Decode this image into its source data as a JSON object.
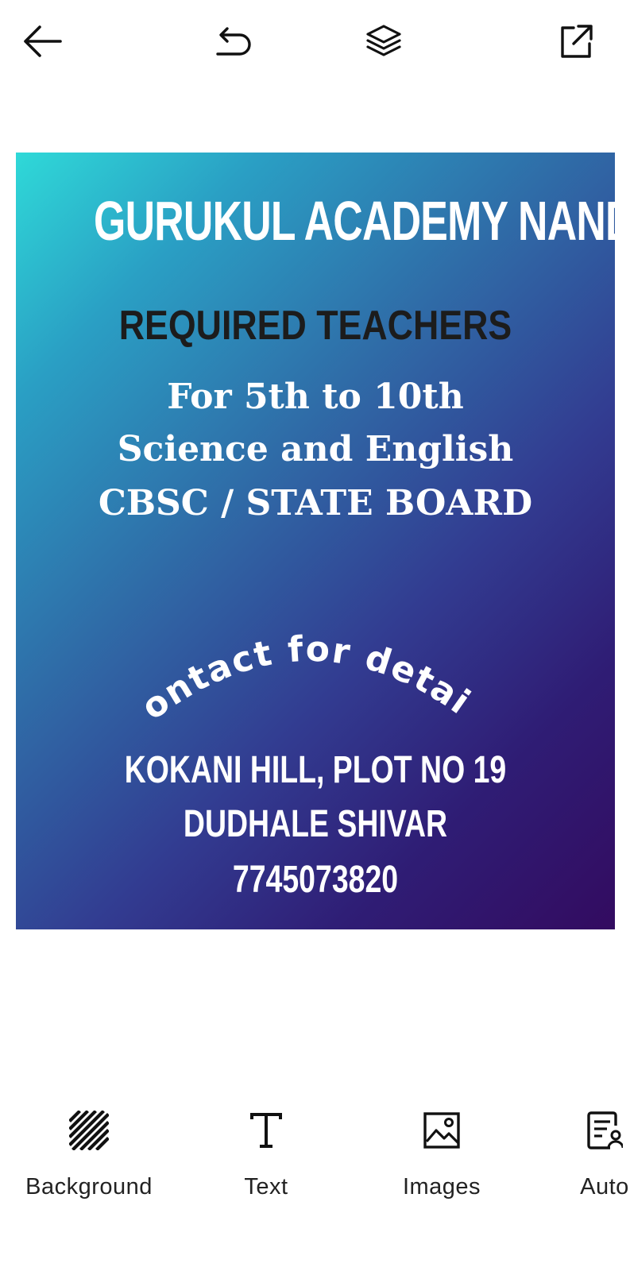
{
  "toolbar": {
    "back_icon": "arrow-left-icon",
    "undo_icon": "undo-icon",
    "layers_icon": "layers-icon",
    "share_icon": "external-share-icon"
  },
  "poster": {
    "title": "GURUKUL ACADEMY NANDURBAR",
    "subtitle": "REQUIRED TEACHERS",
    "line1": "For 5th to 10th",
    "line2": "Science and English",
    "line3": "CBSC / STATE BOARD",
    "contact": "Contact for details",
    "address1": "KOKANI HILL, PLOT NO 19",
    "address2": "DUDHALE SHIVAR",
    "phone": "7745073820",
    "gradient_start": "#2fd9d8",
    "gradient_end": "#330b60"
  },
  "tools": [
    {
      "label": "Background",
      "icon": "hatch-pattern-icon"
    },
    {
      "label": "Text",
      "icon": "text-t-icon"
    },
    {
      "label": "Images",
      "icon": "image-icon"
    },
    {
      "label": "Auto",
      "icon": "form-icon"
    }
  ]
}
